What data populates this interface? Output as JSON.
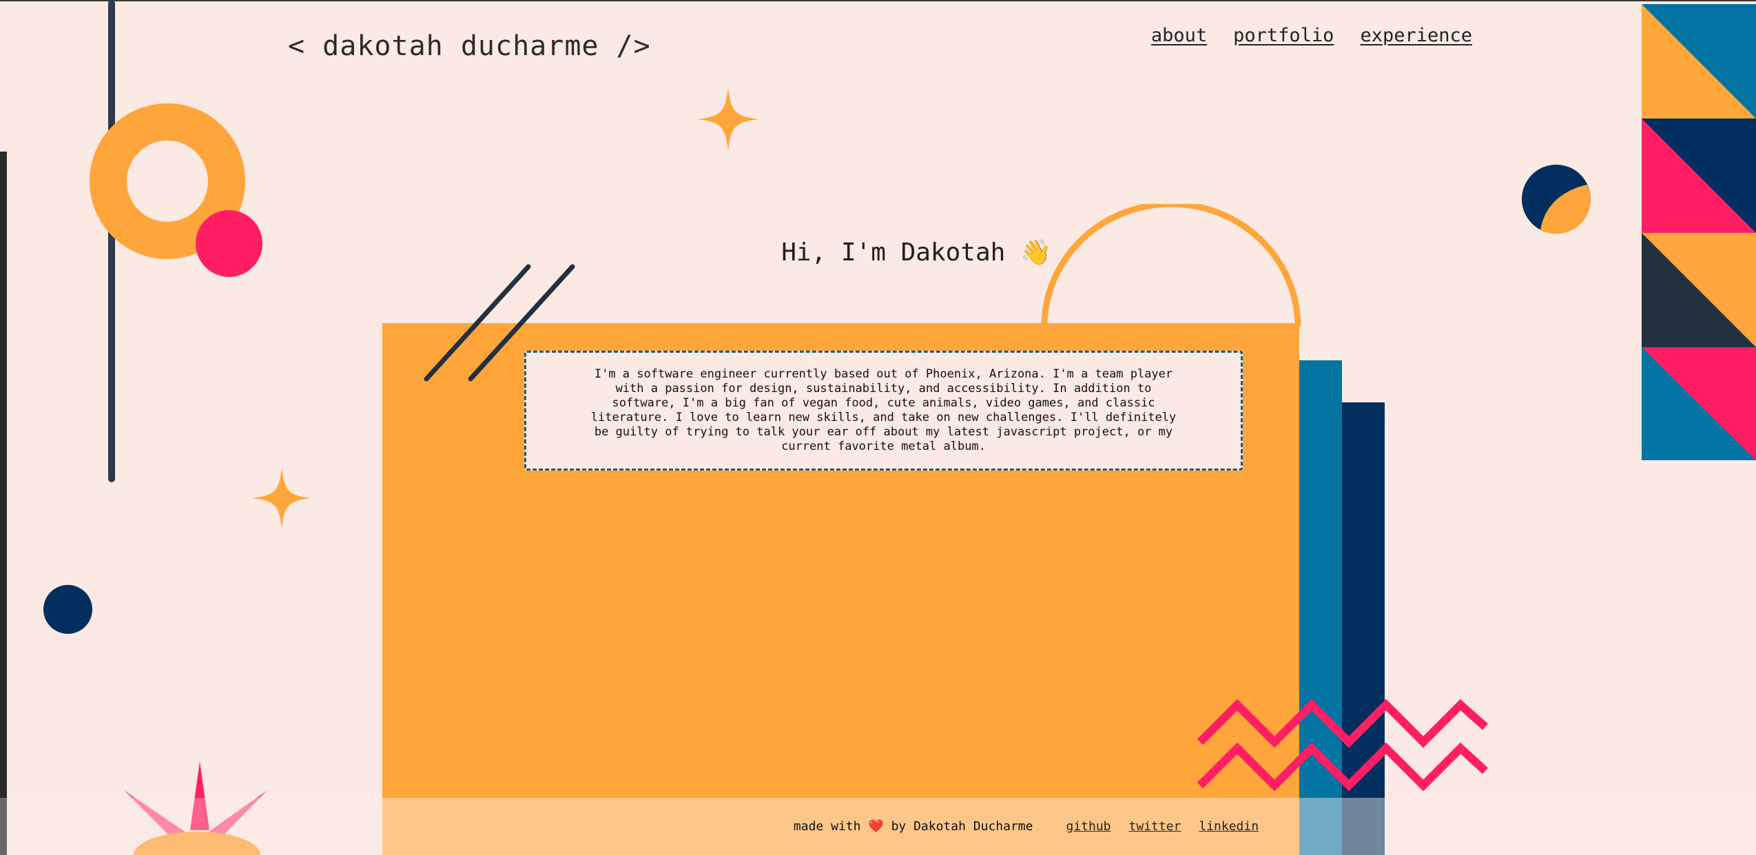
{
  "header": {
    "logo": "< dakotah ducharme />",
    "nav": [
      "about",
      "portfolio",
      "experience"
    ]
  },
  "hero": {
    "greeting": "Hi, I'm Dakotah 👋",
    "bio": "I'm a software engineer currently based out of Phoenix, Arizona. I'm a team player with a passion for design, sustainability, and accessibility. In addition to software, I'm a big fan of vegan food, cute animals, video games, and classic literature. I love to learn new skills, and take on new challenges. I'll definitely be guilty of trying to talk your ear off about my latest javascript project, or my current favorite metal album."
  },
  "footer": {
    "made_with": "made with",
    "heart": "❤️",
    "by": "by Dakotah Ducharme",
    "links": [
      "github",
      "twitter",
      "linkedin"
    ]
  },
  "colors": {
    "background": "#fbe9e3",
    "orange": "#fea63b",
    "pink": "#ff1e64",
    "navy": "#022f5f",
    "teal": "#0374a1",
    "charcoal": "#23313f"
  }
}
